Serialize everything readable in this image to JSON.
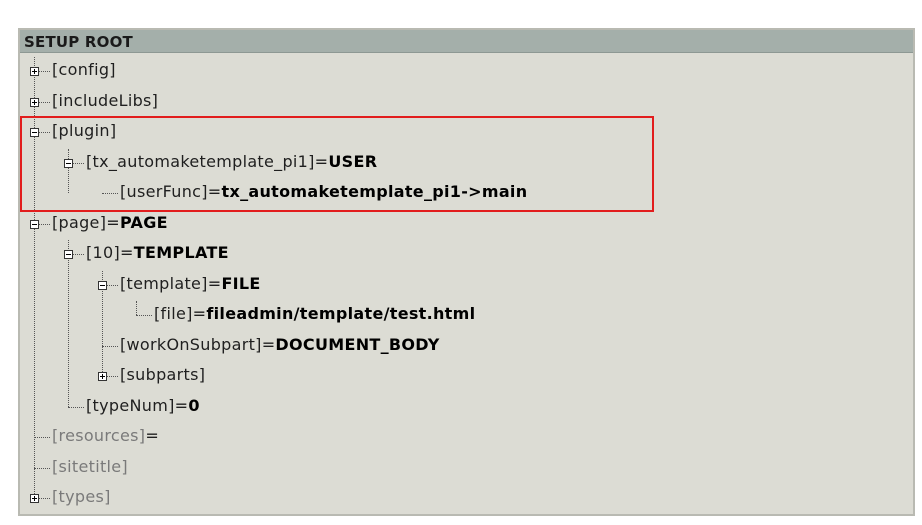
{
  "header": {
    "title": "SETUP ROOT"
  },
  "nodes": [
    {
      "key": "[config]",
      "value": ""
    },
    {
      "key": "[includeLibs]",
      "value": ""
    },
    {
      "key": "[plugin]",
      "value": ""
    },
    {
      "key": "[tx_automaketemplate_pi1]",
      "value": "USER"
    },
    {
      "key": "[userFunc]",
      "value": "tx_automaketemplate_pi1->main"
    },
    {
      "key": "[page]",
      "value": "PAGE"
    },
    {
      "key": "[10]",
      "value": "TEMPLATE"
    },
    {
      "key": "[template]",
      "value": "FILE"
    },
    {
      "key": "[file]",
      "value": "fileadmin/template/test.html"
    },
    {
      "key": "[workOnSubpart]",
      "value": "DOCUMENT_BODY"
    },
    {
      "key": "[subparts]",
      "value": ""
    },
    {
      "key": "[typeNum]",
      "value": "0"
    },
    {
      "key": "[resources]",
      "value": ""
    },
    {
      "key": "[sitetitle]",
      "value": ""
    },
    {
      "key": "[types]",
      "value": ""
    }
  ],
  "colors": {
    "highlight": "#e21d1d",
    "header_bg": "#a4afaa",
    "panel_bg": "#dcdcd4"
  }
}
